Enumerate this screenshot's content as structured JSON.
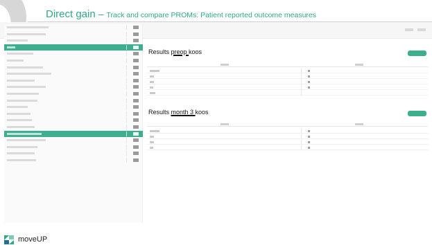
{
  "slide": {
    "title": "Direct gain",
    "separator": "–",
    "subtitle": "Track and compare PROMs: Patient reported outcome measures"
  },
  "colors": {
    "accent": "#2fa888",
    "selected_row": "#3dae8e"
  },
  "sidebar": {
    "selected_rows": [
      3,
      16
    ]
  },
  "sections": [
    {
      "prefix": "Results ",
      "emphasis": "preop ",
      "suffix": "koos"
    },
    {
      "prefix": "Results ",
      "emphasis": "month 3 ",
      "suffix": "koos"
    }
  ],
  "footer": {
    "logo_text": "moveUP",
    "logo_icon": "moveup-logo-icon"
  }
}
